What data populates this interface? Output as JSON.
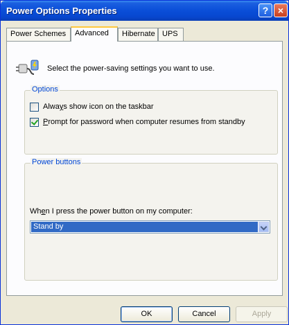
{
  "window": {
    "title": "Power Options Properties"
  },
  "titlebar": {
    "help": "?",
    "close": "×"
  },
  "tabs": [
    {
      "label": "Power Schemes",
      "active": false
    },
    {
      "label": "Advanced",
      "active": true
    },
    {
      "label": "Hibernate",
      "active": false
    },
    {
      "label": "UPS",
      "active": false
    }
  ],
  "intro": {
    "text": "Select the power-saving settings you want to use."
  },
  "options": {
    "legend": "Options",
    "show_icon": {
      "label_pre": "Alwa",
      "label_u": "y",
      "label_post": "s show icon on the taskbar",
      "checked": false
    },
    "prompt_password": {
      "label_pre": "",
      "label_u": "P",
      "label_post": "rompt for password when computer resumes from standby",
      "checked": true
    }
  },
  "power_buttons": {
    "legend": "Power buttons",
    "combo_label_pre": "Wh",
    "combo_label_u": "e",
    "combo_label_post": "n I press the power button on my computer:",
    "selected": "Stand by"
  },
  "buttons": {
    "ok": "OK",
    "cancel": "Cancel",
    "apply": "Apply"
  },
  "colors": {
    "title_bar": "#0a4ed8",
    "dialog_bg": "#ece9d8",
    "legend_text": "#0046d5",
    "selection": "#316ac5"
  }
}
